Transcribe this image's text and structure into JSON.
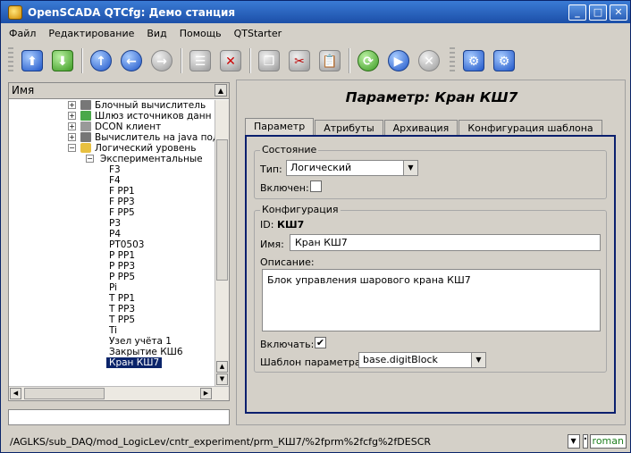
{
  "window": {
    "title": "OpenSCADA QTCfg: Демо станция",
    "controls": [
      "_",
      "□",
      "✕"
    ]
  },
  "menu": {
    "items": [
      "Файл",
      "Редактирование",
      "Вид",
      "Помощь",
      "QTStarter"
    ]
  },
  "toolbar": {
    "buttons": [
      "db-load-icon",
      "db-save-icon",
      "up-icon",
      "back-icon",
      "forward-icon",
      "add-item-icon",
      "delete-item-icon",
      "copy-icon",
      "cut-icon",
      "paste-icon",
      "refresh-icon",
      "start-icon",
      "stop-icon",
      "connect-icon",
      "disconnect-icon"
    ]
  },
  "tree": {
    "header": "Имя",
    "items": [
      {
        "label": "Блочный вычислитель",
        "icon": "calc",
        "expand": "+"
      },
      {
        "label": "Шлюз источников данн",
        "icon": "gateway",
        "expand": "+"
      },
      {
        "label": "DCON клиент",
        "icon": "dcon",
        "expand": "+"
      },
      {
        "label": "Вычислитель на java под",
        "icon": "calc",
        "expand": "+"
      },
      {
        "label": "Логический уровень",
        "icon": "folder",
        "expand": "−"
      },
      {
        "label": "Экспериментальные",
        "icon": "",
        "expand": "−"
      },
      {
        "label": "F3",
        "icon": "",
        "expand": ""
      },
      {
        "label": "F4",
        "icon": "",
        "expand": ""
      },
      {
        "label": "F PP1",
        "icon": "",
        "expand": ""
      },
      {
        "label": "F PP3",
        "icon": "",
        "expand": ""
      },
      {
        "label": "F PP5",
        "icon": "",
        "expand": ""
      },
      {
        "label": "P3",
        "icon": "",
        "expand": ""
      },
      {
        "label": "P4",
        "icon": "",
        "expand": ""
      },
      {
        "label": "PT0503",
        "icon": "",
        "expand": ""
      },
      {
        "label": "P PP1",
        "icon": "",
        "expand": ""
      },
      {
        "label": "P PP3",
        "icon": "",
        "expand": ""
      },
      {
        "label": "P PP5",
        "icon": "",
        "expand": ""
      },
      {
        "label": "Pi",
        "icon": "",
        "expand": ""
      },
      {
        "label": "T PP1",
        "icon": "",
        "expand": ""
      },
      {
        "label": "T PP3",
        "icon": "",
        "expand": ""
      },
      {
        "label": "T PP5",
        "icon": "",
        "expand": ""
      },
      {
        "label": "Ti",
        "icon": "",
        "expand": ""
      },
      {
        "label": "Узел учёта 1",
        "icon": "",
        "expand": ""
      },
      {
        "label": "Закрытие КШ6",
        "icon": "",
        "expand": ""
      },
      {
        "label": "Кран КШ7",
        "icon": "",
        "expand": "",
        "selected": true
      }
    ]
  },
  "panel": {
    "title": "Параметр: Кран КШ7",
    "tabs": [
      "Параметр",
      "Атрибуты",
      "Архивация",
      "Конфигурация шаблона"
    ],
    "state": {
      "group_title": "Состояние",
      "type_label": "Тип:",
      "type_value": "Логический",
      "enabled_label": "Включен:",
      "enabled": false
    },
    "config": {
      "group_title": "Конфигурация",
      "id_label": "ID:",
      "id_value": "КШ7",
      "name_label": "Имя:",
      "name_value": "Кран КШ7",
      "descr_label": "Описание:",
      "descr_value": "Блок управления шарового крана КШ7",
      "to_enable_label": "Включать:",
      "to_enable": true,
      "template_label": "Шаблон параметра:",
      "template_value": "base.digitBlock"
    }
  },
  "status": {
    "path": "/AGLKS/sub_DAQ/mod_LogicLev/cntr_experiment/prm_КШ7/%2fprm%2fcfg%2fDESCR",
    "user": "roman"
  }
}
